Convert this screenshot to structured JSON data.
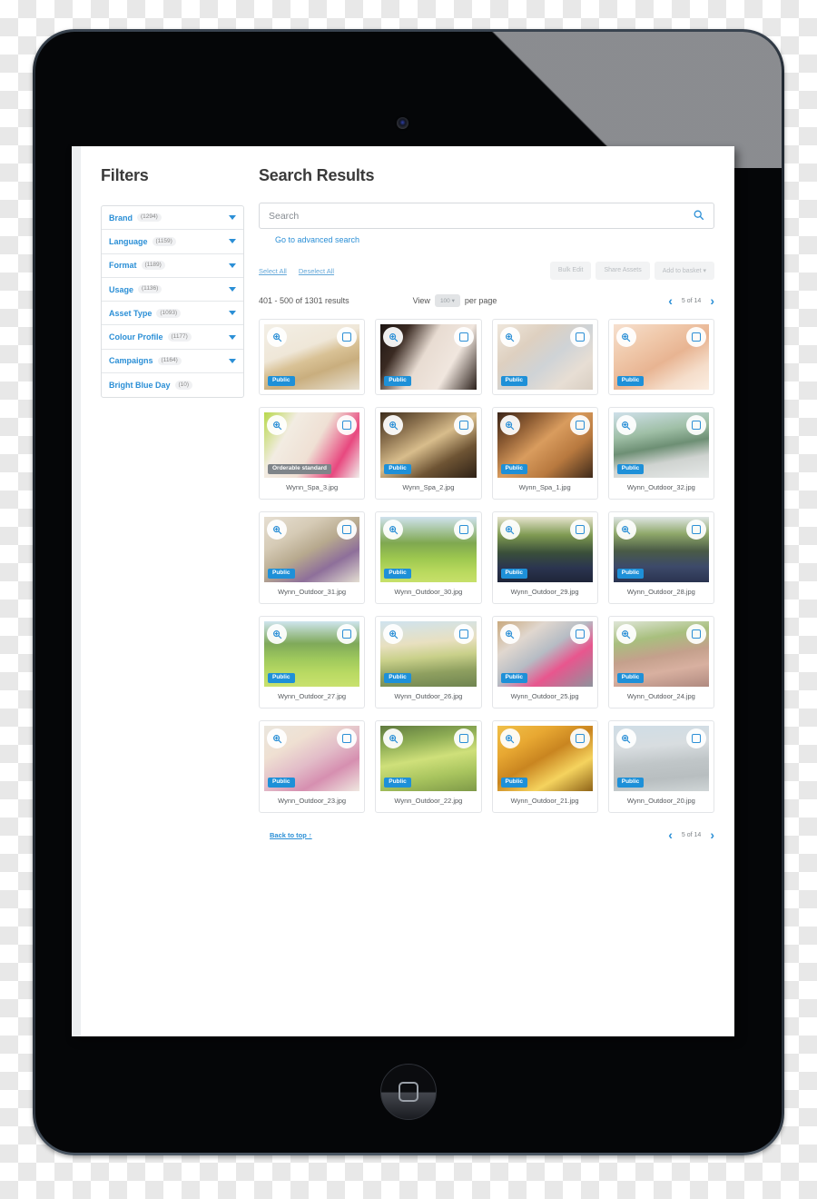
{
  "device": {
    "home_button_icon": "rounded-square-icon",
    "camera_icon": "camera-icon"
  },
  "sidebar": {
    "title": "Filters",
    "items": [
      {
        "label": "Brand",
        "count": "(1294)",
        "caret": true
      },
      {
        "label": "Language",
        "count": "(1159)",
        "caret": true
      },
      {
        "label": "Format",
        "count": "(1189)",
        "caret": true
      },
      {
        "label": "Usage",
        "count": "(1136)",
        "caret": true
      },
      {
        "label": "Asset Type",
        "count": "(1093)",
        "caret": true
      },
      {
        "label": "Colour Profile",
        "count": "(1177)",
        "caret": true
      },
      {
        "label": "Campaigns",
        "count": "(1164)",
        "caret": true
      },
      {
        "label": "Bright Blue Day",
        "count": "(10)",
        "caret": false
      }
    ]
  },
  "main": {
    "title": "Search Results",
    "search": {
      "value": "",
      "placeholder": "Search",
      "icon": "search-icon"
    },
    "advanced_search_link": "Go to advanced search",
    "select_all": "Select All",
    "deselect_all": "Deselect All",
    "buttons": [
      {
        "label": "Bulk Edit"
      },
      {
        "label": "Share Assets"
      },
      {
        "label": "Add to basket ▾"
      }
    ],
    "results_count": "401 - 500 of 1301 results",
    "view_prefix": "View",
    "per_page_value": "100 ▾",
    "view_suffix": "per page",
    "pager": {
      "prev": "‹",
      "next": "›",
      "label": "5 of 14"
    },
    "back_to_top": "Back to top ↑"
  },
  "grid": {
    "rows": [
      [
        {
          "name": "",
          "badge": "Public",
          "badge_type": "public",
          "art": "spa-reception"
        },
        {
          "name": "",
          "badge": "Public",
          "badge_type": "public",
          "art": "robes-selfie"
        },
        {
          "name": "",
          "badge": "Public",
          "badge_type": "public",
          "art": "robes-lounge"
        },
        {
          "name": "",
          "badge": "Public",
          "badge_type": "public",
          "art": "facemasks"
        }
      ],
      [
        {
          "name": "Wynn_Spa_3.jpg",
          "badge": "Orderable standard",
          "badge_type": "orderable",
          "art": "circle-faces"
        },
        {
          "name": "Wynn_Spa_2.jpg",
          "badge": "Public",
          "badge_type": "public",
          "art": "sauna-pool"
        },
        {
          "name": "Wynn_Spa_1.jpg",
          "badge": "Public",
          "badge_type": "public",
          "art": "relax-loungers"
        },
        {
          "name": "Wynn_Outdoor_32.jpg",
          "badge": "Public",
          "badge_type": "public",
          "art": "cyclist-road"
        }
      ],
      [
        {
          "name": "Wynn_Outdoor_31.jpg",
          "badge": "Public",
          "badge_type": "public",
          "art": "shoe-tie"
        },
        {
          "name": "Wynn_Outdoor_30.jpg",
          "badge": "Public",
          "badge_type": "public",
          "art": "park-stretch"
        },
        {
          "name": "Wynn_Outdoor_29.jpg",
          "badge": "Public",
          "badge_type": "public",
          "art": "crowd-arms-1"
        },
        {
          "name": "Wynn_Outdoor_28.jpg",
          "badge": "Public",
          "badge_type": "public",
          "art": "crowd-arms-2"
        }
      ],
      [
        {
          "name": "Wynn_Outdoor_27.jpg",
          "badge": "Public",
          "badge_type": "public",
          "art": "group-lawn"
        },
        {
          "name": "Wynn_Outdoor_26.jpg",
          "badge": "Public",
          "badge_type": "public",
          "art": "family-run"
        },
        {
          "name": "Wynn_Outdoor_25.jpg",
          "badge": "Public",
          "badge_type": "public",
          "art": "mat-situps"
        },
        {
          "name": "Wynn_Outdoor_24.jpg",
          "badge": "Public",
          "badge_type": "public",
          "art": "runner-path"
        }
      ],
      [
        {
          "name": "Wynn_Outdoor_23.jpg",
          "badge": "Public",
          "badge_type": "public",
          "art": "yoga-pair"
        },
        {
          "name": "Wynn_Outdoor_22.jpg",
          "badge": "Public",
          "badge_type": "public",
          "art": "plank-group"
        },
        {
          "name": "Wynn_Outdoor_21.jpg",
          "badge": "Public",
          "badge_type": "public",
          "art": "autumn-shoes"
        },
        {
          "name": "Wynn_Outdoor_20.jpg",
          "badge": "Public",
          "badge_type": "public",
          "art": "pier-yoga"
        }
      ]
    ],
    "zoom_icon": "magnifier-plus-icon",
    "check_icon": "checkbox-icon"
  },
  "colors": {
    "accent_blue": "#2b8fd6",
    "badge_blue": "#1e90d8",
    "badge_gray": "#7f8489",
    "text_gray": "#55595d"
  }
}
